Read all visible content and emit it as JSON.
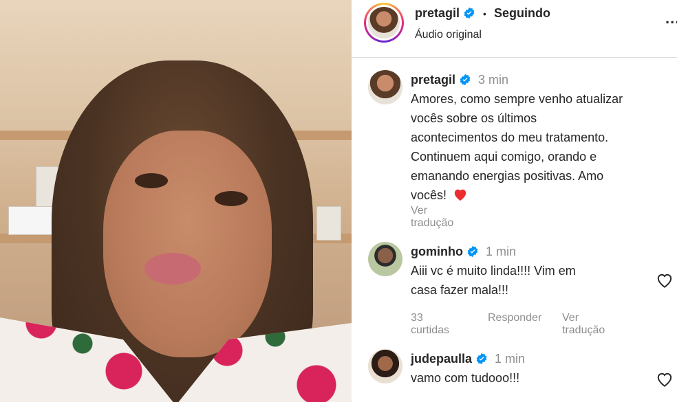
{
  "header": {
    "username": "pretagil",
    "separator": "•",
    "follow_status": "Seguindo",
    "audio": "Áudio original",
    "more": "..."
  },
  "caption": {
    "username": "pretagil",
    "time": "3 min",
    "lines": [
      "Amores, como sempre venho atualizar",
      "vocês sobre os últimos",
      "acontecimentos do meu tratamento.",
      "Continuem aqui comigo, orando e",
      "emanando energias positivas. Amo",
      "vocês!"
    ],
    "see_translation": "Ver tradução"
  },
  "comments": [
    {
      "username": "gominho",
      "time": "1 min",
      "lines": [
        "Aiii vc é muito linda!!!! Vim em",
        "casa fazer mala!!!"
      ],
      "likes": "33 curtidas",
      "reply": "Responder",
      "see_translation": "Ver tradução"
    },
    {
      "username": "judepaulla",
      "time": "1 min",
      "lines": [
        "vamo com tudooo!!!"
      ]
    }
  ],
  "colors": {
    "verified_blue": "#0095f6",
    "heart_red": "#ed2c2c",
    "muted_text": "#8e8e8e"
  }
}
